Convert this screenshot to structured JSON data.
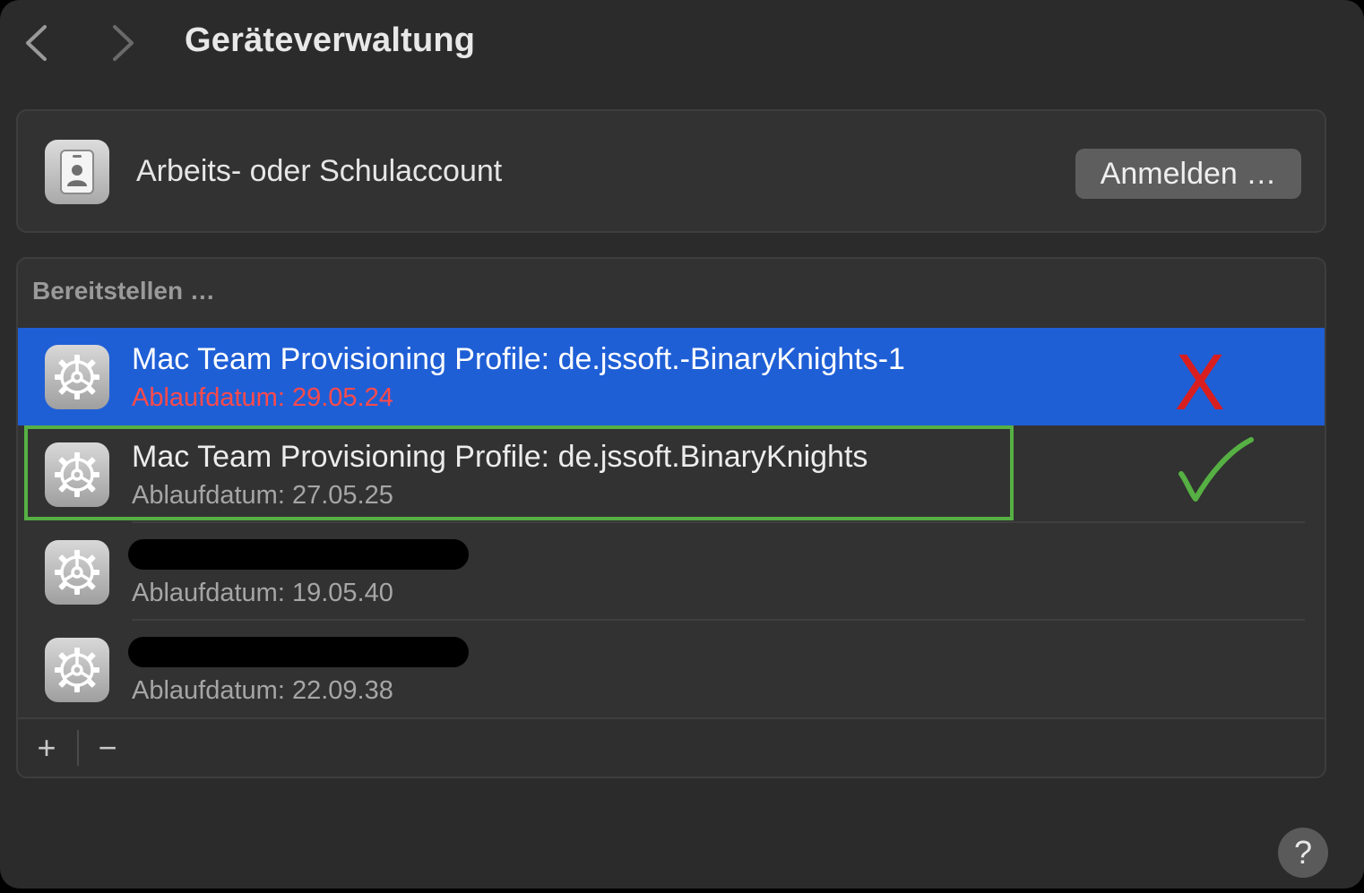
{
  "header": {
    "title": "Geräteverwaltung",
    "back_icon": "chevron-left-icon",
    "forward_icon": "chevron-right-icon"
  },
  "account": {
    "label": "Arbeits- oder Schulaccount",
    "button_label": "Anmelden …",
    "icon": "id-badge-icon"
  },
  "profiles": {
    "section_title": "Bereitstellen …",
    "items": [
      {
        "name": "Mac Team Provisioning Profile: de.jssoft.-BinaryKnights-1",
        "expiry": "Ablaufdatum: 29.05.24",
        "selected": true,
        "expired": true,
        "icon": "gear-icon"
      },
      {
        "name": "Mac Team Provisioning Profile: de.jssoft.BinaryKnights",
        "expiry": "Ablaufdatum: 27.05.25",
        "selected": false,
        "expired": false,
        "icon": "gear-icon"
      },
      {
        "name": "",
        "expiry": "Ablaufdatum: 19.05.40",
        "redacted": true,
        "icon": "gear-icon"
      },
      {
        "name": "",
        "expiry": "Ablaufdatum: 22.09.38",
        "redacted": true,
        "icon": "gear-icon"
      }
    ]
  },
  "annotations": {
    "cross_mark": "X",
    "cross_color": "#d81e1e",
    "check_color": "#56b043",
    "highlight_color": "#56b043"
  },
  "toolbar": {
    "add_label": "+",
    "remove_label": "−"
  },
  "help": {
    "label": "?"
  },
  "colors": {
    "selection": "#1f5fd6",
    "expired_text": "#ff4a4a",
    "background": "#2b2b2b"
  }
}
